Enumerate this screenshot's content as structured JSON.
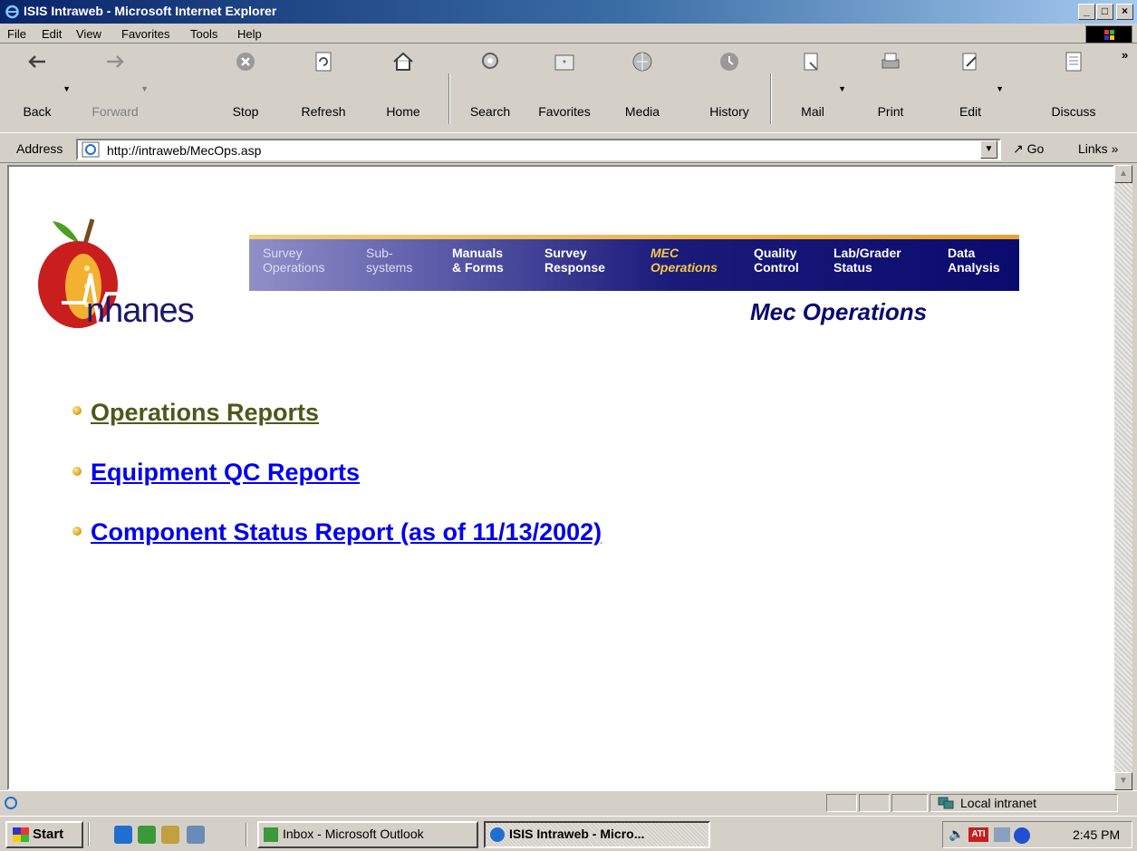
{
  "window": {
    "title": "ISIS Intraweb - Microsoft Internet Explorer",
    "controls": [
      "_",
      "□",
      "×"
    ]
  },
  "menu": [
    "File",
    "Edit",
    "View",
    "Favorites",
    "Tools",
    "Help"
  ],
  "toolbar": {
    "buttons": [
      {
        "label": "Back",
        "icon": "back-arrow-icon"
      },
      {
        "label": "Forward",
        "icon": "forward-arrow-icon"
      },
      {
        "label": "Stop",
        "icon": "stop-icon"
      },
      {
        "label": "Refresh",
        "icon": "refresh-icon"
      },
      {
        "label": "Home",
        "icon": "home-icon"
      },
      {
        "label": "Search",
        "icon": "search-icon"
      },
      {
        "label": "Favorites",
        "icon": "favorites-icon"
      },
      {
        "label": "Media",
        "icon": "media-icon"
      },
      {
        "label": "History",
        "icon": "history-icon"
      },
      {
        "label": "Mail",
        "icon": "mail-icon"
      },
      {
        "label": "Print",
        "icon": "print-icon"
      },
      {
        "label": "Edit",
        "icon": "edit-icon"
      },
      {
        "label": "Discuss",
        "icon": "discuss-icon"
      }
    ],
    "overflow": "»"
  },
  "address": {
    "label": "Address",
    "url": "http://intraweb/MecOps.asp",
    "go": "Go",
    "links": "Links"
  },
  "banner": {
    "brand": "nhanes",
    "nav": [
      {
        "label": "Survey\nOperations",
        "state": "light"
      },
      {
        "label": "Sub-\nsystems",
        "state": "light"
      },
      {
        "label": "Manuals\n& Forms",
        "state": "normal"
      },
      {
        "label": "Survey\nResponse",
        "state": "normal"
      },
      {
        "label": "MEC\nOperations",
        "state": "active"
      },
      {
        "label": "Quality\nControl",
        "state": "normal"
      },
      {
        "label": "Lab/Grader\nStatus",
        "state": "normal"
      },
      {
        "label": "Data\nAnalysis",
        "state": "normal"
      }
    ],
    "page_title": "Mec Operations"
  },
  "links": [
    {
      "label": "Operations Reports",
      "visited": true
    },
    {
      "label": "Equipment QC Reports",
      "visited": false
    },
    {
      "label": "Component Status Report (as of 11/13/2002)",
      "visited": false
    }
  ],
  "statusbar": {
    "zone": "Local intranet"
  },
  "taskbar": {
    "start": "Start",
    "tasks": [
      {
        "label": "Inbox - Microsoft Outlook",
        "active": false
      },
      {
        "label": "ISIS Intraweb - Micro...",
        "active": true
      }
    ],
    "clock": "2:45 PM"
  },
  "colors": {
    "link": "#0000ee",
    "visited_link": "#4a5a1a",
    "banner_dark": "#0b0b6e",
    "active_nav": "#f7c84a"
  }
}
